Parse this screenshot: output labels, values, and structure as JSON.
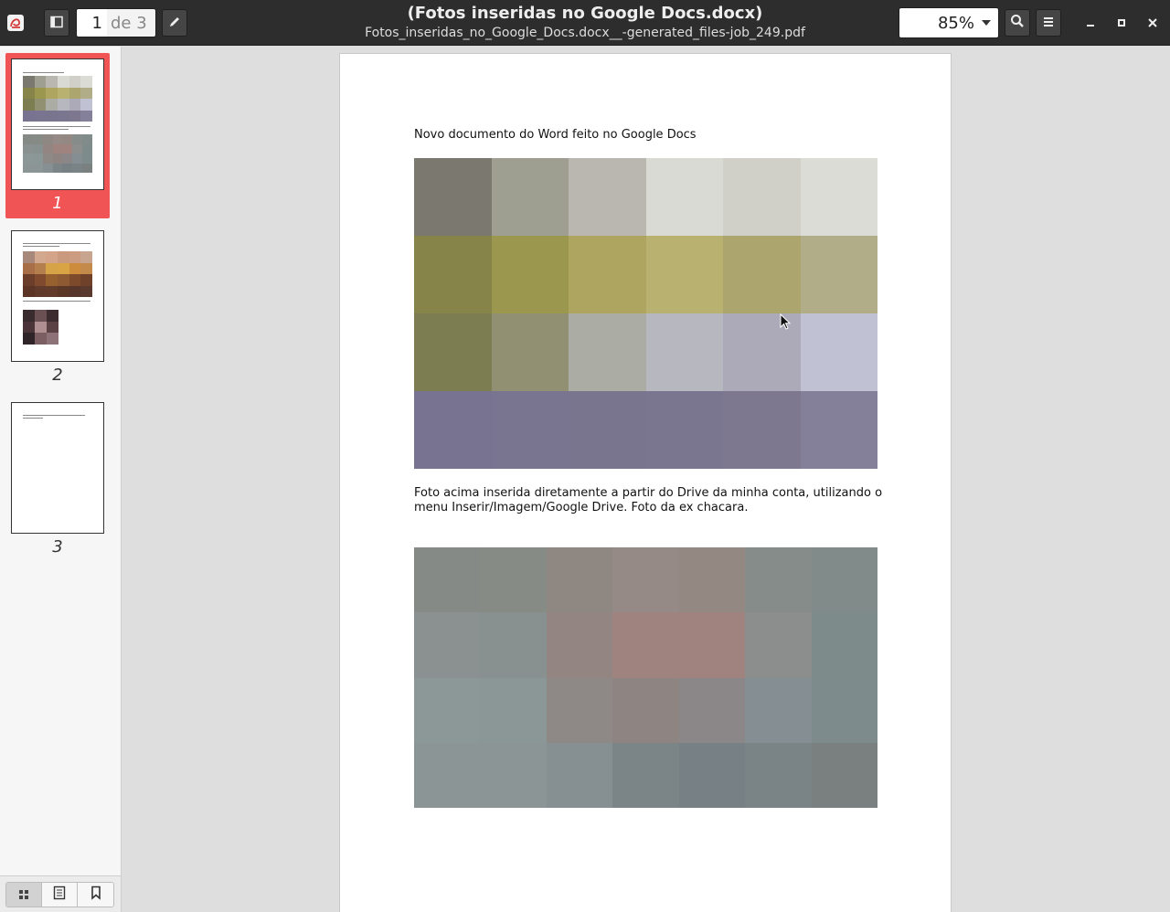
{
  "header": {
    "title": "(Fotos inseridas no Google Docs.docx)",
    "subtitle": "Fotos_inseridas_no_Google_Docs.docx__-generated_files-job_249.pdf",
    "current_page": "1",
    "page_total": "de 3",
    "zoom": "85%",
    "icons": [
      "app-icon",
      "sidebar-toggle-icon",
      "pencil-icon",
      "search-icon",
      "hamburger-menu-icon",
      "minimize-icon",
      "maximize-icon",
      "close-icon"
    ]
  },
  "sidebar": {
    "thumbnails": [
      {
        "label": "1",
        "selected": true
      },
      {
        "label": "2",
        "selected": false
      },
      {
        "label": "3",
        "selected": false
      }
    ],
    "accent": "#f05454",
    "footer_icons": [
      "thumbnails-grid-icon",
      "outline-icon",
      "bookmark-icon"
    ]
  },
  "document": {
    "heading": "Novo documento do Word feito no Google Docs",
    "caption1": "Foto acima inserida diretamente a partir do Drive da minha conta, utilizando o",
    "caption2": "menu Inserir/Imagem/Google Drive.  Foto da ex chacara.",
    "image1_colors": [
      [
        "#7b7870",
        "#9f9f91",
        "#bab7b0",
        "#dadad5",
        "#d0d0c8",
        "#dcdcd6"
      ],
      [
        "#878449",
        "#9c974e",
        "#aea561",
        "#b9b16f",
        "#aca56e",
        "#b1ad88"
      ],
      [
        "#7c7d50",
        "#929073",
        "#abaca4",
        "#b7b7bf",
        "#acaab8",
        "#c0c1d3"
      ],
      [
        "#787390",
        "#79748f",
        "#7a758f",
        "#7b7690",
        "#7d7890",
        "#858099"
      ]
    ],
    "image2_colors": [
      [
        "#868a87",
        "#878b86",
        "#8e8782",
        "#958a85",
        "#938982",
        "#858c8a",
        "#808b8a"
      ],
      [
        "#8b9190",
        "#899090",
        "#938582",
        "#9f837e",
        "#a0837f",
        "#8b8e8c",
        "#7e8b8b"
      ],
      [
        "#8c9797",
        "#8b9797",
        "#8e8886",
        "#8e8583",
        "#8b8789",
        "#858f93",
        "#7e8b8c"
      ],
      [
        "#8b9596",
        "#8b9596",
        "#869092",
        "#7b8588",
        "#778185",
        "#7a8385",
        "#79807f"
      ]
    ]
  }
}
